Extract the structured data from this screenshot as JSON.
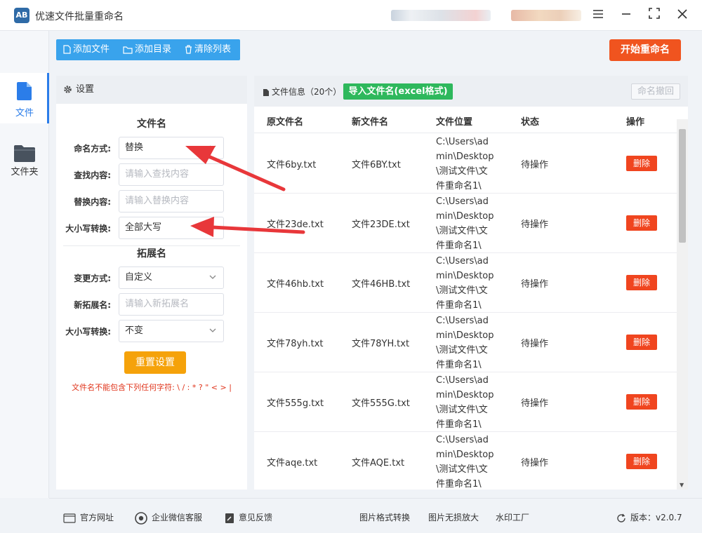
{
  "app": {
    "title": "优速文件批量重命名",
    "logo_text": "AB"
  },
  "window": {
    "menu_icon": "hamburger-icon",
    "minimize_icon": "minimize-icon",
    "maximize_icon": "maximize-icon",
    "close_icon": "close-icon"
  },
  "nav": [
    {
      "label": "文件",
      "icon": "file-icon",
      "active": true
    },
    {
      "label": "文件夹",
      "icon": "folder-icon",
      "active": false
    }
  ],
  "toolbar": {
    "add_file": "添加文件",
    "add_dir": "添加目录",
    "clear_list": "清除列表",
    "start": "开始重命名"
  },
  "settings": {
    "header": "设置",
    "filename_section": "文件名",
    "naming_mode_label": "命名方式:",
    "naming_mode_value": "替换",
    "find_label": "查找内容:",
    "find_placeholder": "请输入查找内容",
    "replace_label": "替换内容:",
    "replace_placeholder": "请输入替换内容",
    "case_label": "大小写转换:",
    "case_value": "全部大写",
    "ext_section": "拓展名",
    "change_mode_label": "变更方式:",
    "change_mode_value": "自定义",
    "new_ext_label": "新拓展名:",
    "new_ext_placeholder": "请输入新拓展名",
    "ext_case_label": "大小写转换:",
    "ext_case_value": "不变",
    "reset": "重置设置",
    "warning": "文件名不能包含下列任何字符: \\ / : * ? \" < > |"
  },
  "files": {
    "info": "文件信息（20个）",
    "import": "导入文件名(excel格式)",
    "undo": "命名撤回",
    "columns": {
      "original": "原文件名",
      "new": "新文件名",
      "location": "文件位置",
      "status": "状态",
      "action": "操作"
    },
    "rows": [
      {
        "original": "文件6by.txt",
        "new": "文件6BY.txt",
        "location": "C:\\Users\\admin\\Desktop\\测试文件\\文件重命名1\\",
        "status": "待操作",
        "action": "删除"
      },
      {
        "original": "文件23de.txt",
        "new": "文件23DE.txt",
        "location": "C:\\Users\\admin\\Desktop\\测试文件\\文件重命名1\\",
        "status": "待操作",
        "action": "删除"
      },
      {
        "original": "文件46hb.txt",
        "new": "文件46HB.txt",
        "location": "C:\\Users\\admin\\Desktop\\测试文件\\文件重命名1\\",
        "status": "待操作",
        "action": "删除"
      },
      {
        "original": "文件78yh.txt",
        "new": "文件78YH.txt",
        "location": "C:\\Users\\admin\\Desktop\\测试文件\\文件重命名1\\",
        "status": "待操作",
        "action": "删除"
      },
      {
        "original": "文件555g.txt",
        "new": "文件555G.txt",
        "location": "C:\\Users\\admin\\Desktop\\测试文件\\文件重命名1\\",
        "status": "待操作",
        "action": "删除"
      },
      {
        "original": "文件aqe.txt",
        "new": "文件AQE.txt",
        "location": "C:\\Users\\admin\\Desktop\\测试文件\\文件重命名1\\",
        "status": "待操作",
        "action": "删除"
      }
    ]
  },
  "footer": {
    "website": "官方网址",
    "wechat": "企业微信客服",
    "feedback": "意见反馈",
    "img_convert": "图片格式转换",
    "img_enlarge": "图片无损放大",
    "watermark": "水印工厂",
    "version": "版本：v2.0.7"
  },
  "colors": {
    "accent_blue": "#39a3ec",
    "start_red": "#f0541f",
    "import_green": "#2eb85c",
    "reset_orange": "#f5a20a",
    "delete_red": "#f0451f",
    "annotation_arrow": "#e8373a"
  }
}
